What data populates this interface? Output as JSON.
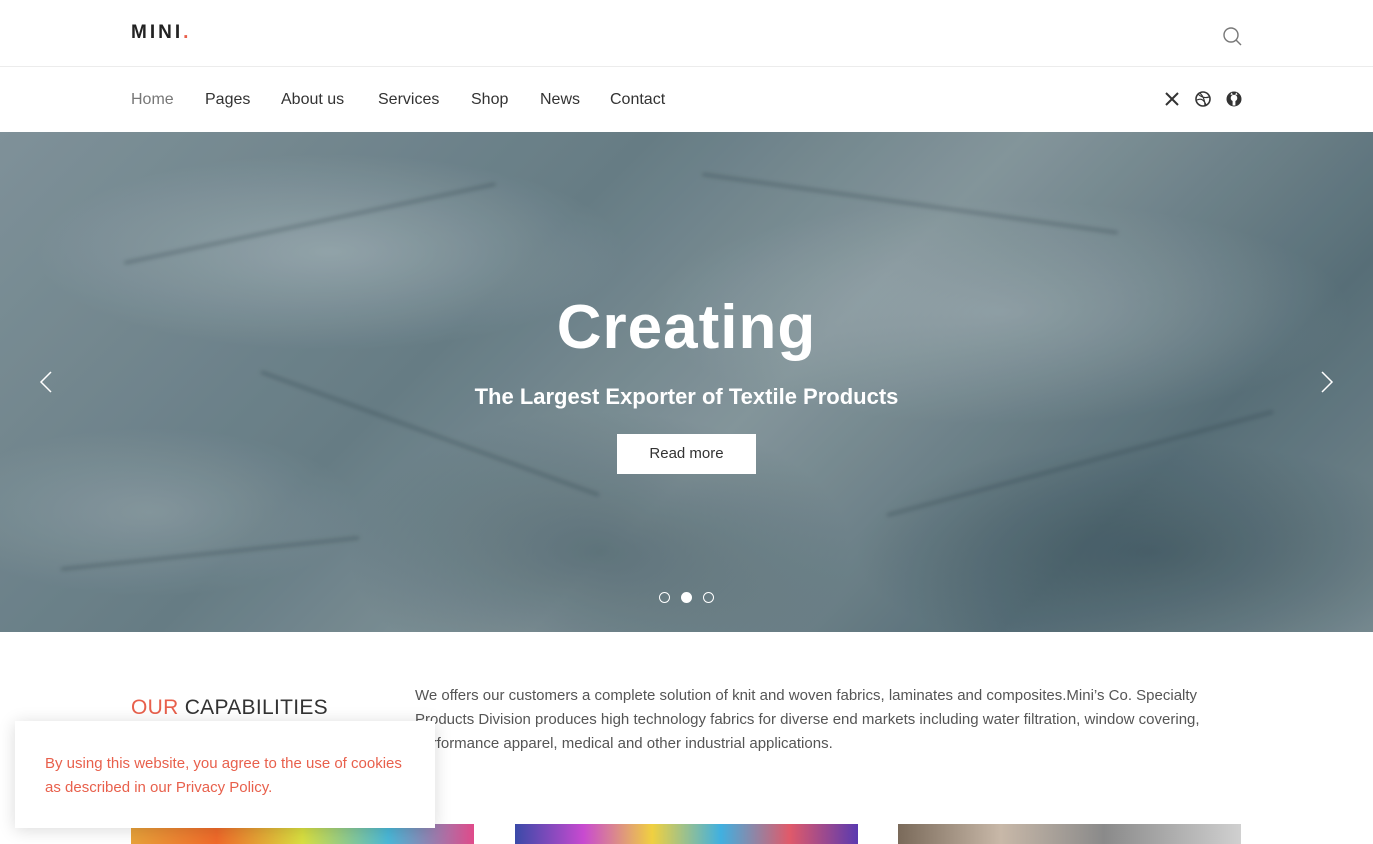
{
  "brand": {
    "name": "MINI",
    "dot": "."
  },
  "nav": {
    "items": [
      {
        "label": "Home",
        "active": true
      },
      {
        "label": "Pages"
      },
      {
        "label": "About us"
      },
      {
        "label": "Services"
      },
      {
        "label": "Shop"
      },
      {
        "label": "News"
      },
      {
        "label": "Contact"
      }
    ],
    "social": [
      "x-twitter-icon",
      "dribbble-icon",
      "github-icon"
    ]
  },
  "hero": {
    "title": "Creating",
    "subtitle": "The Largest Exporter of Textile Products",
    "button": "Read more",
    "slide_count": 3,
    "active_slide": 2
  },
  "capabilities": {
    "title_accent": "OUR",
    "title_rest": "CAPABILITIES",
    "text": "We offers our customers a complete solution of knit and woven fabrics, laminates and composites.Mini’s Co. Specialty Products Division produces high technology fabrics for diverse end markets including water filtration, window covering, performance apparel, medical and other industrial applications."
  },
  "cookie": {
    "text": "By using this website, you agree to the use of cookies as described in our Privacy Policy."
  },
  "colors": {
    "accent": "#e8604c",
    "text": "#333333"
  }
}
